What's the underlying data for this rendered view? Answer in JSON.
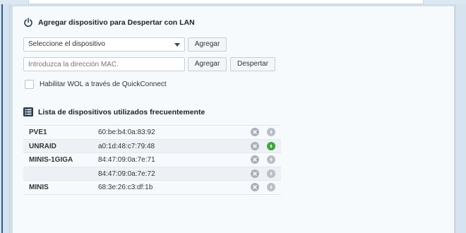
{
  "wol_section": {
    "title": "Agregar dispositivo para Despertar con LAN",
    "device_select": {
      "value": "Seleccione el dispositivo"
    },
    "add_device_button": "Agregar",
    "mac_input": {
      "placeholder": "Introduzca la dirección MAC."
    },
    "add_mac_button": "Agregar",
    "wake_button": "Despertar",
    "quickconnect_checkbox": {
      "label": "Habilitar WOL a través de QuickConnect",
      "checked": false
    }
  },
  "devices_section": {
    "title": "Lista de dispositivos utilizados frecuentemente",
    "devices": [
      {
        "name": "PVE1",
        "mac": "60:be:b4:0a:83:92",
        "online": false
      },
      {
        "name": "UNRAID",
        "mac": "a0:1d:48:c7:79:48",
        "online": true
      },
      {
        "name": "MINIS-1GIGA",
        "mac": "84:47:09:0a:7e:71",
        "online": false
      },
      {
        "name": "",
        "mac": "84:47:09:0a:7e:72",
        "online": false
      },
      {
        "name": "MINIS",
        "mac": "68:3e:26:c3:df:1b",
        "online": false
      }
    ]
  },
  "icons": {
    "section_icon_1": "power-icon",
    "section_icon_2": "list-icon",
    "remove_icon": "remove-circle-icon",
    "wake_icon": "lightning-icon"
  },
  "colors": {
    "accent": "#2e5d8a",
    "online": "#3aa63a",
    "inactive": "#b8bfc5"
  }
}
